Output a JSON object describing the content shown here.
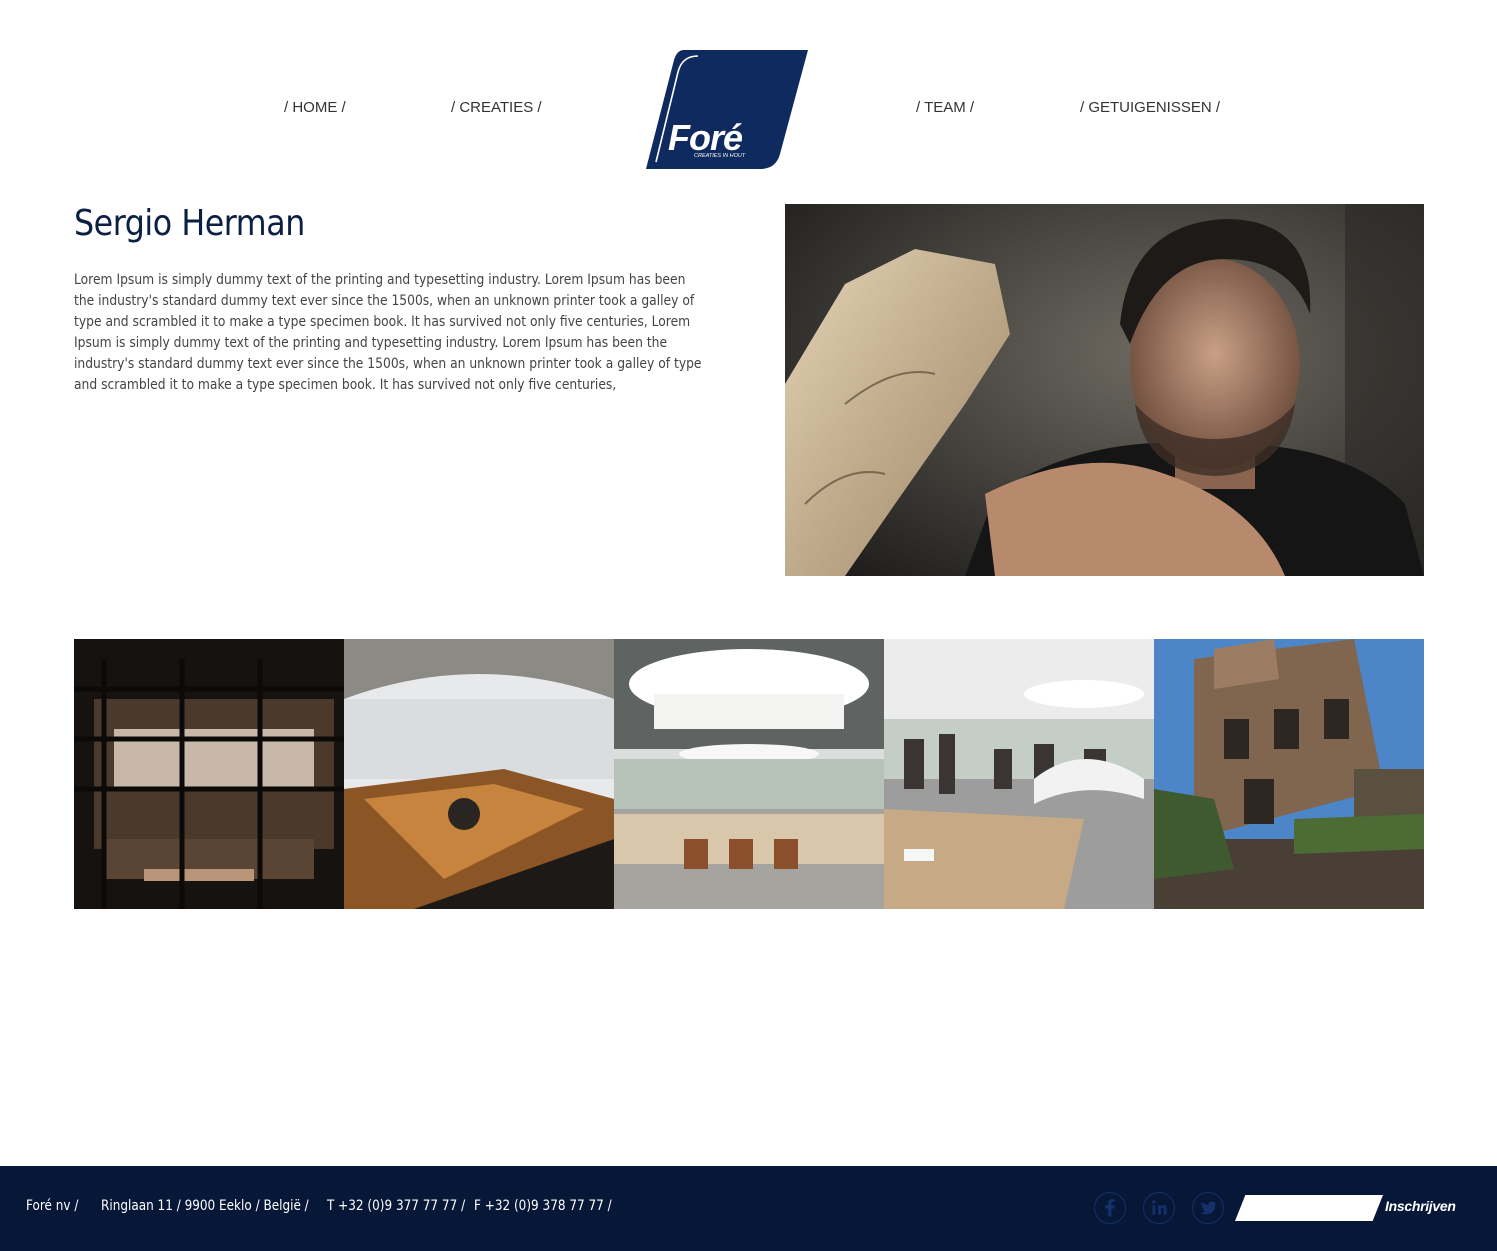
{
  "nav": {
    "home": "/ HOME /",
    "creaties": "/ CREATIES /",
    "team": "/ TEAM /",
    "getuigenissen": "/ GETUIGENISSEN /"
  },
  "logo": {
    "brand": "Foré",
    "tagline": "CREATIES IN HOUT",
    "color": "#0f2a5e"
  },
  "main": {
    "title": "Sergio Herman",
    "intro": "Lorem Ipsum is simply dummy text of the printing and typesetting industry. Lorem Ipsum has been the industry's standard dummy text ever since the 1500s, when an unknown printer took a galley of type and scrambled it to make a type specimen book. It has survived not only five centuries, Lorem Ipsum is simply dummy text of the printing and typesetting industry. Lorem Ipsum has been the industry's standard dummy text ever since the 1500s, when an unknown printer took a galley of type and scrambled it to make a type specimen book. It has survived not only five centuries,"
  },
  "footer": {
    "company": "Foré nv /",
    "address": "Ringlaan 11 / 9900 Eeklo / België /",
    "phone": "T +32 (0)9 377 77 77 /",
    "fax": "F +32 (0)9 378 77 77 /",
    "social_icons": [
      "facebook-icon",
      "linkedin-icon",
      "twitter-icon"
    ],
    "signup_placeholder": "",
    "signup_label": "Inschrijven",
    "background": "#061737"
  }
}
